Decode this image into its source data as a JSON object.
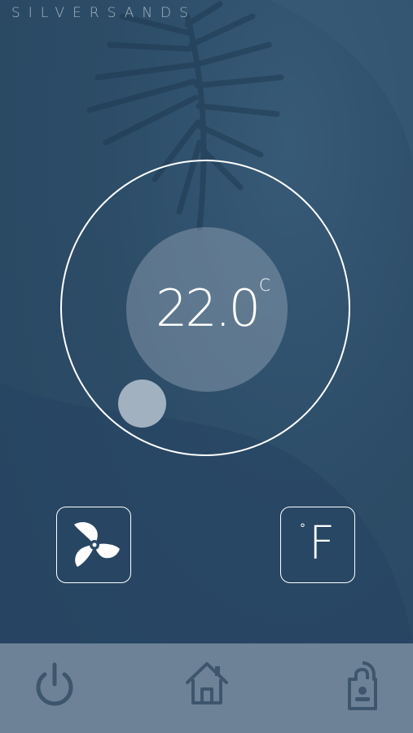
{
  "app": {
    "brand": "SILVERSANDS"
  },
  "thermostat": {
    "temperature": "22.0",
    "unit": "C"
  },
  "controls": {
    "fan_icon": "fan-icon",
    "unit_toggle_degree": "°",
    "unit_toggle_letter": "F"
  },
  "bottom_bar": {
    "items": [
      {
        "icon": "power-icon"
      },
      {
        "icon": "home-icon"
      },
      {
        "icon": "door-hanger-icon"
      }
    ]
  },
  "colors": {
    "background": "#2c4c67",
    "accent": "#ffffff",
    "knob": "#a2b1c0",
    "bottom_bar": "#6d8296",
    "bar_icon": "#3e566d"
  }
}
